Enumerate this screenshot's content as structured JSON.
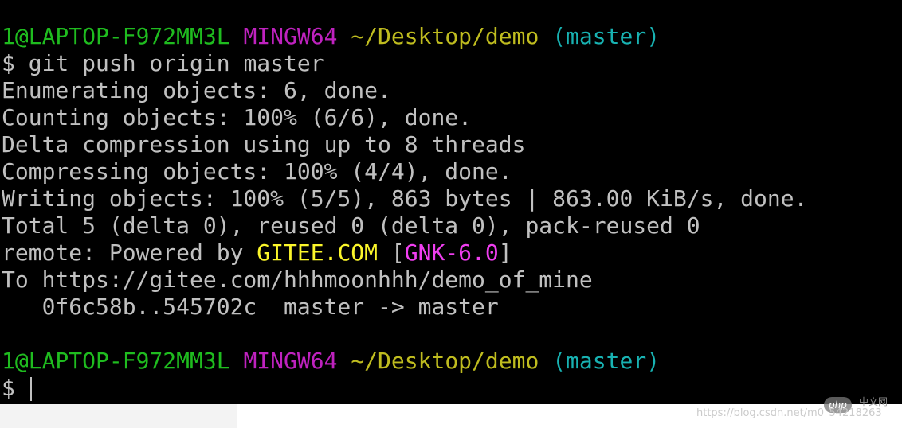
{
  "prompt": {
    "user_host": "1@LAPTOP-F972MM3L",
    "system": "MINGW64",
    "cwd": "~/Desktop/demo",
    "branch": "(master)",
    "symbol": "$"
  },
  "command": "git push origin master",
  "output": {
    "enumerating": "Enumerating objects: 6, done.",
    "counting": "Counting objects: 100% (6/6), done.",
    "delta": "Delta compression using up to 8 threads",
    "compressing": "Compressing objects: 100% (4/4), done.",
    "writing": "Writing objects: 100% (5/5), 863 bytes | 863.00 KiB/s, done.",
    "total": "Total 5 (delta 0), reused 0 (delta 0), pack-reused 0",
    "remote_prefix": "remote: Powered by ",
    "remote_host": "GITEE.COM",
    "remote_bracket_open": "[",
    "remote_version": "GNK-6.0",
    "remote_bracket_close": "]",
    "to_url": "To https://gitee.com/hhhmoonhhh/demo_of_mine",
    "ref_update": "   0f6c58b..545702c  master -> master"
  },
  "watermark": {
    "logo": "php",
    "cn": "中文网",
    "url": "https://blog.csdn.net/m0_54218263"
  },
  "colors": {
    "background": "#000000",
    "text": "#c0c0c0",
    "user_host": "#1fbc1f",
    "system": "#bf22bf",
    "cwd": "#bfbc1f",
    "branch": "#18b2b2",
    "remote_host": "#fbf62a",
    "remote_version": "#f03ef0"
  }
}
